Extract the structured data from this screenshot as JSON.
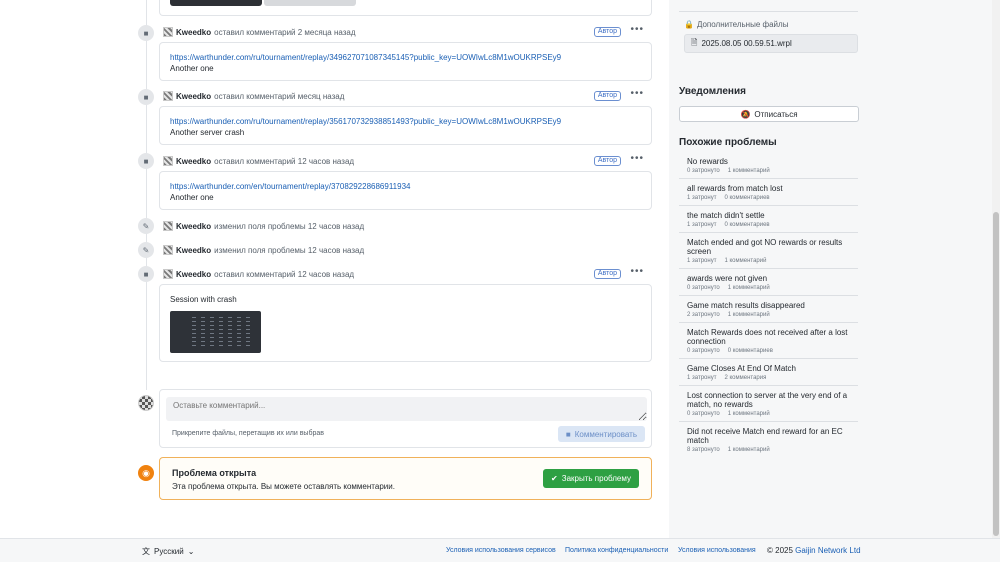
{
  "timeline": {
    "events": [
      {
        "type": "comment",
        "icon": "comment-icon",
        "user": "Kweedko",
        "action": "оставил комментарий 2 месяца назад",
        "badge": "Автор",
        "link": "https://warthunder.com/ru/tournament/replay/349627071087345145?public_key=UOWIwLc8M1wOUKRPSEy9",
        "text": "Another one"
      },
      {
        "type": "comment",
        "icon": "comment-icon",
        "user": "Kweedko",
        "action": "оставил комментарий месяц назад",
        "badge": "Автор",
        "link": "https://warthunder.com/ru/tournament/replay/356170732938851493?public_key=UOWIwLc8M1wOUKRPSEy9",
        "text": "Another server crash"
      },
      {
        "type": "comment",
        "icon": "comment-icon",
        "user": "Kweedko",
        "action": "оставил комментарий 12 часов назад",
        "badge": "Автор",
        "link": "https://warthunder.com/en/tournament/replay/370829228686911934",
        "text": "Another one"
      },
      {
        "type": "edit",
        "icon": "pencil-icon",
        "user": "Kweedko",
        "action": "изменил поля проблемы 12 часов назад"
      },
      {
        "type": "edit",
        "icon": "pencil-icon",
        "user": "Kweedko",
        "action": "изменил поля проблемы 12 часов назад"
      },
      {
        "type": "comment",
        "icon": "comment-icon",
        "user": "Kweedko",
        "action": "оставил комментарий 12 часов назад",
        "badge": "Автор",
        "text": "Session with crash"
      }
    ]
  },
  "comment_form": {
    "placeholder": "Оставьте комментарий...",
    "attach_hint": "Прикрепите файлы, перетащив их или выбрав",
    "submit_label": "Комментировать"
  },
  "status": {
    "title": "Проблема открыта",
    "subtitle": "Эта проблема открыта. Вы можете оставлять комментарии.",
    "close_label": "Закрыть проблему"
  },
  "sidebar": {
    "files_label": "Дополнительные файлы",
    "file_name": "2025.08.05 00.59.51.wrpl",
    "notifications_title": "Уведомления",
    "unsubscribe_label": "Отписаться",
    "similar_title": "Похожие проблемы",
    "similar": [
      {
        "title": "No rewards",
        "affected": "0 затронуто",
        "comments": "1 комментарий"
      },
      {
        "title": "all rewards from match lost",
        "affected": "1 затронут",
        "comments": "0 комментариев"
      },
      {
        "title": "the match didn't settle",
        "affected": "1 затронут",
        "comments": "0 комментариев"
      },
      {
        "title": "Match ended and got NO rewards or results screen",
        "affected": "1 затронут",
        "comments": "1 комментарий"
      },
      {
        "title": "awards were not given",
        "affected": "0 затронуто",
        "comments": "1 комментарий"
      },
      {
        "title": "Game match results disappeared",
        "affected": "2 затронуто",
        "comments": "1 комментарий"
      },
      {
        "title": "Match Rewards does not received after a lost connection",
        "affected": "0 затронуто",
        "comments": "0 комментариев"
      },
      {
        "title": "Game Closes At End Of Match",
        "affected": "1 затронут",
        "comments": "2 комментария"
      },
      {
        "title": "Lost connection to server at the very end of a match, no rewards",
        "affected": "0 затронуто",
        "comments": "1 комментарий"
      },
      {
        "title": "Did not receive Match end reward for an EC match",
        "affected": "8 затронуто",
        "comments": "1 комментарий"
      }
    ]
  },
  "footer": {
    "language": "Русский",
    "terms": "Условия использования сервисов",
    "privacy": "Политика конфиденциальности",
    "usage": "Условия использования",
    "copyright_prefix": "© 2025",
    "company": "Gaijin Network Ltd"
  },
  "colors": {
    "link": "#1a5fb4",
    "badge": "#3f6fc5",
    "close_button": "#2ea043",
    "open_accent": "#f0820f"
  }
}
